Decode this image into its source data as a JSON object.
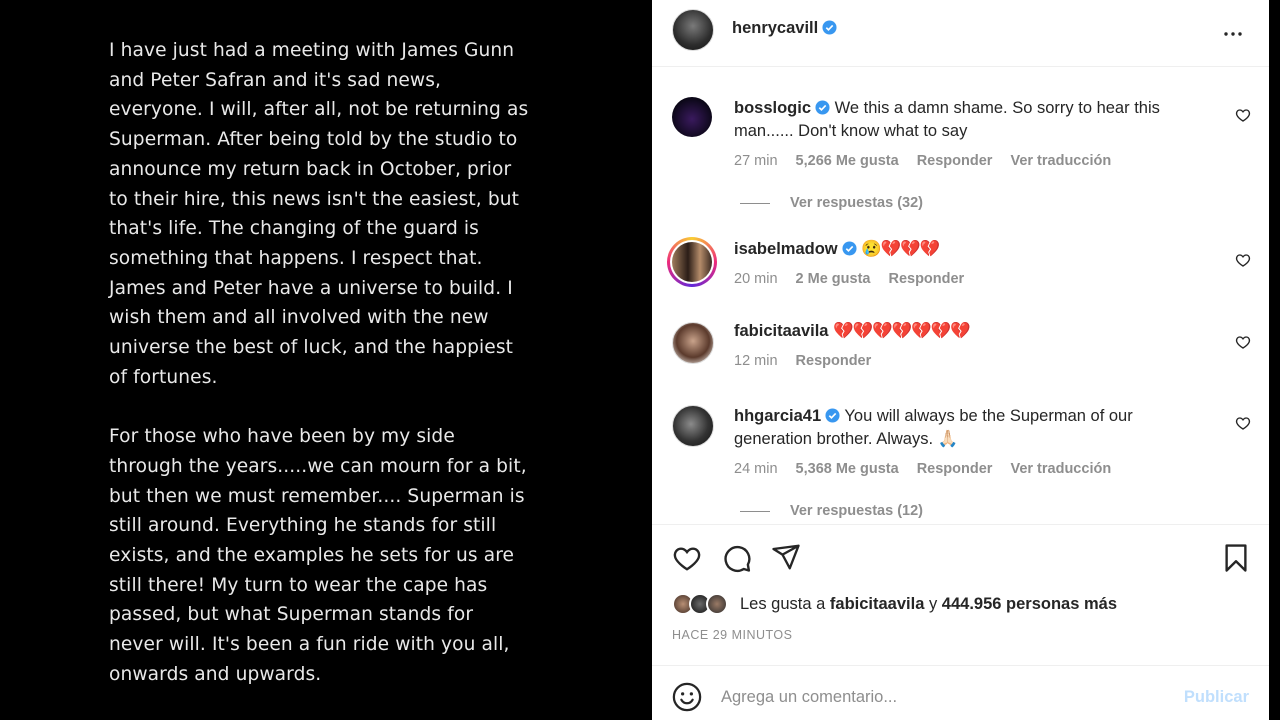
{
  "post": {
    "paragraphs": [
      "I have just had a meeting with James Gunn\nand Peter Safran and it's sad news,\neveryone. I will, after all, not be returning as\nSuperman. After being told by the studio to\nannounce my return back in October, prior\nto their hire, this news isn't the easiest, but\nthat's life. The changing of the guard is\nsomething that happens. I respect that.\nJames and Peter have a universe to build. I\nwish them and all involved with the new\nuniverse the best of luck, and the happiest\nof fortunes.",
      "For those who have been by my side\nthrough the years.....we can mourn for a bit,\nbut then we must remember.... Superman is\nstill around. Everything he stands for still\nexists, and the examples he sets for us are\nstill there! My turn to wear the cape has\npassed, but what Superman stands for\nnever will. It's been a fun ride with you all,\nonwards and upwards."
    ]
  },
  "header": {
    "username": "henrycavill",
    "verified": true
  },
  "comments": [
    {
      "username": "bosslogic",
      "verified": true,
      "text": "We this a damn shame. So sorry to hear this man...... Don't know what to say",
      "time": "27 min",
      "likes": "5,266 Me gusta",
      "reply": "Responder",
      "translate": "Ver traducción",
      "replies": "Ver respuestas (32)"
    },
    {
      "username": "isabelmadow",
      "verified": true,
      "text": "😢💔💔💔",
      "time": "20 min",
      "likes": "2 Me gusta",
      "reply": "Responder"
    },
    {
      "username": "fabicitaavila",
      "verified": false,
      "text": "💔💔💔💔💔💔💔",
      "time": "12 min",
      "reply": "Responder"
    },
    {
      "username": "hhgarcia41",
      "verified": true,
      "text": "You will always be the Superman of our generation brother. Always. 🙏🏻",
      "time": "24 min",
      "likes": "5,368 Me gusta",
      "reply": "Responder",
      "translate": "Ver traducción",
      "replies": "Ver respuestas (12)"
    }
  ],
  "likes": {
    "prefix": "Les gusta a ",
    "user": "fabicitaavila",
    "middle": " y ",
    "count": "444.956 personas más"
  },
  "timestamp": "HACE 29 MINUTOS",
  "add_comment": {
    "placeholder": "Agrega un comentario...",
    "publish": "Publicar"
  },
  "icons": [
    "verified-icon",
    "more-options-icon",
    "heart-icon",
    "comment-icon",
    "share-icon",
    "bookmark-icon",
    "emoji-icon"
  ],
  "colors": {
    "verified": "#3897f0",
    "text": "#262626",
    "muted": "#8e8e8e",
    "publish": "#c0dffd"
  }
}
